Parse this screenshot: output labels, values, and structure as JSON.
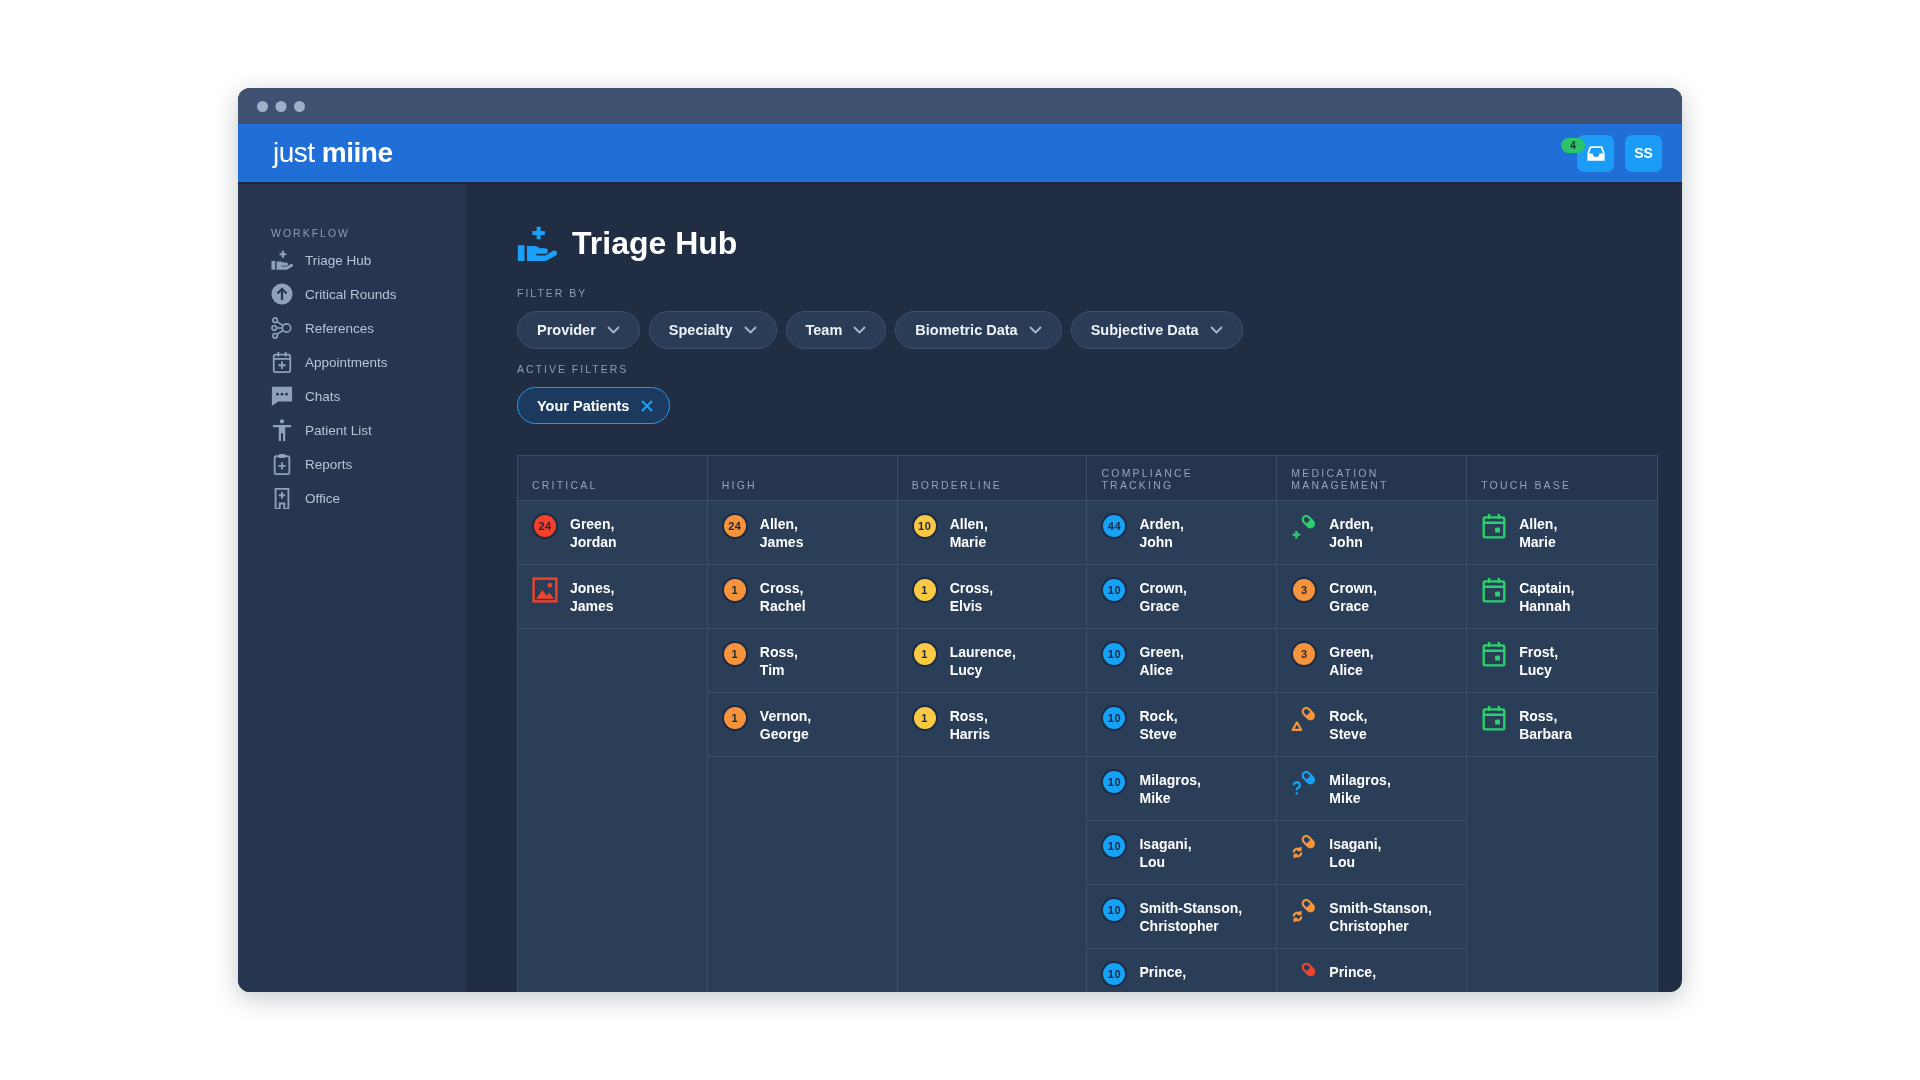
{
  "header": {
    "logo": "just **miine**",
    "inbox": {
      "badge": "4"
    },
    "avatar": {
      "initials": "SS"
    }
  },
  "sidebar": {
    "section": "WORKFLOW",
    "items": [
      {
        "label": "Triage Hub"
      },
      {
        "label": "Critical Rounds"
      },
      {
        "label": "References"
      },
      {
        "label": "Appointments"
      },
      {
        "label": "Chats"
      },
      {
        "label": "Patient List"
      },
      {
        "label": "Reports"
      },
      {
        "label": "Office"
      }
    ]
  },
  "page": {
    "title": "Triage Hub",
    "filter_label": "FILTER BY",
    "filters": [
      "Provider",
      "Specialty",
      "Team",
      "Biometric Data",
      "Subjective Data"
    ],
    "active_label": "ACTIVE FILTERS",
    "active_filters": [
      "Your Patients"
    ]
  },
  "board": {
    "columns": [
      {
        "title": "CRITICAL",
        "cards": [
          {
            "marker": {
              "kind": "count",
              "count": "24",
              "color": "#f3412c"
            },
            "last_name": "Green,",
            "first_name": "Jordan"
          },
          {
            "marker": {
              "kind": "image",
              "color": "#f3412c"
            },
            "last_name": "Jones,",
            "first_name": "James"
          }
        ]
      },
      {
        "title": "HIGH",
        "cards": [
          {
            "marker": {
              "kind": "count",
              "count": "24",
              "color": "#f5943c"
            },
            "last_name": "Allen,",
            "first_name": "James"
          },
          {
            "marker": {
              "kind": "count",
              "count": "1",
              "color": "#f5943c"
            },
            "last_name": "Cross,",
            "first_name": "Rachel"
          },
          {
            "marker": {
              "kind": "count",
              "count": "1",
              "color": "#f5943c"
            },
            "last_name": "Ross,",
            "first_name": "Tim"
          },
          {
            "marker": {
              "kind": "count",
              "count": "1",
              "color": "#f5943c"
            },
            "last_name": "Vernon,",
            "first_name": "George"
          }
        ]
      },
      {
        "title": "BORDERLINE",
        "cards": [
          {
            "marker": {
              "kind": "count",
              "count": "10",
              "color": "#f9c944"
            },
            "last_name": "Allen,",
            "first_name": "Marie"
          },
          {
            "marker": {
              "kind": "count",
              "count": "1",
              "color": "#f9c944"
            },
            "last_name": "Cross,",
            "first_name": "Elvis"
          },
          {
            "marker": {
              "kind": "count",
              "count": "1",
              "color": "#f9c944"
            },
            "last_name": "Laurence,",
            "first_name": "Lucy"
          },
          {
            "marker": {
              "kind": "count",
              "count": "1",
              "color": "#f9c944"
            },
            "last_name": "Ross,",
            "first_name": "Harris"
          }
        ]
      },
      {
        "title": "COMPLIANCE TRACKING",
        "cards": [
          {
            "marker": {
              "kind": "count",
              "count": "44",
              "color": "#16a2f6"
            },
            "last_name": "Arden,",
            "first_name": "John"
          },
          {
            "marker": {
              "kind": "count",
              "count": "10",
              "color": "#16a2f6"
            },
            "last_name": "Crown,",
            "first_name": "Grace"
          },
          {
            "marker": {
              "kind": "count",
              "count": "10",
              "color": "#16a2f6"
            },
            "last_name": "Green,",
            "first_name": "Alice"
          },
          {
            "marker": {
              "kind": "count",
              "count": "10",
              "color": "#16a2f6"
            },
            "last_name": "Rock,",
            "first_name": "Steve"
          },
          {
            "marker": {
              "kind": "count",
              "count": "10",
              "color": "#16a2f6"
            },
            "last_name": "Milagros,",
            "first_name": "Mike"
          },
          {
            "marker": {
              "kind": "count",
              "count": "10",
              "color": "#16a2f6"
            },
            "last_name": "Isagani,",
            "first_name": "Lou"
          },
          {
            "marker": {
              "kind": "count",
              "count": "10",
              "color": "#16a2f6"
            },
            "last_name": "Smith-Stanson,",
            "first_name": "Christopher"
          },
          {
            "marker": {
              "kind": "count",
              "count": "10",
              "color": "#16a2f6"
            },
            "last_name": "Prince,"
          }
        ]
      },
      {
        "title": "MEDICATION MANAGEMENT",
        "cards": [
          {
            "marker": {
              "kind": "pill-plus",
              "color": "#2ccf6e"
            },
            "last_name": "Arden,",
            "first_name": "John"
          },
          {
            "marker": {
              "kind": "count",
              "count": "3",
              "color": "#f5943c"
            },
            "last_name": "Crown,",
            "first_name": "Grace"
          },
          {
            "marker": {
              "kind": "count",
              "count": "3",
              "color": "#f5943c"
            },
            "last_name": "Green,",
            "first_name": "Alice"
          },
          {
            "marker": {
              "kind": "pill-warning",
              "color": "#f5943c"
            },
            "last_name": "Rock,",
            "first_name": "Steve"
          },
          {
            "marker": {
              "kind": "pill-question",
              "color": "#16a2f6"
            },
            "last_name": "Milagros,",
            "first_name": "Mike"
          },
          {
            "marker": {
              "kind": "pill-refresh",
              "color": "#f5943c"
            },
            "last_name": "Isagani,",
            "first_name": "Lou"
          },
          {
            "marker": {
              "kind": "pill-refresh",
              "color": "#f5943c"
            },
            "last_name": "Smith-Stanson,",
            "first_name": "Christopher"
          },
          {
            "marker": {
              "kind": "pill",
              "color": "#f3412c"
            },
            "last_name": "Prince,"
          }
        ]
      },
      {
        "title": "TOUCH BASE",
        "cards": [
          {
            "marker": {
              "kind": "calendar",
              "color": "#2ccf6e"
            },
            "last_name": "Allen,",
            "first_name": "Marie"
          },
          {
            "marker": {
              "kind": "calendar",
              "color": "#2ccf6e"
            },
            "last_name": "Captain,",
            "first_name": "Hannah"
          },
          {
            "marker": {
              "kind": "calendar",
              "color": "#2ccf6e"
            },
            "last_name": "Frost,",
            "first_name": "Lucy"
          },
          {
            "marker": {
              "kind": "calendar",
              "color": "#2ccf6e"
            },
            "last_name": "Ross,",
            "first_name": "Barbara"
          }
        ]
      }
    ]
  }
}
